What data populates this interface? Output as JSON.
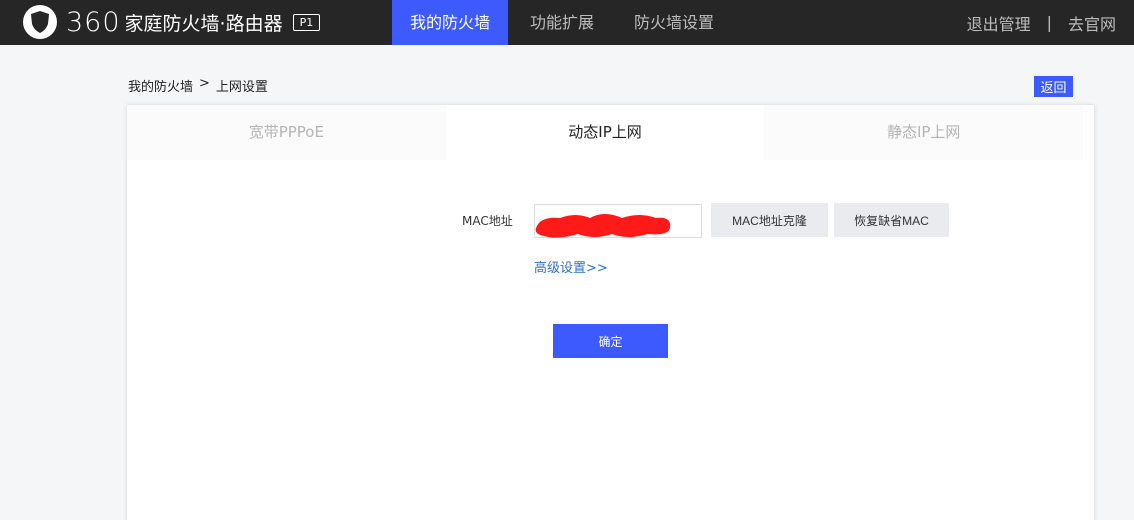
{
  "header": {
    "brand_number": "360",
    "brand_name": "家庭防火墙·路由器",
    "brand_badge": "P1",
    "nav": [
      {
        "label": "我的防火墙",
        "active": true
      },
      {
        "label": "功能扩展",
        "active": false
      },
      {
        "label": "防火墙设置",
        "active": false
      }
    ],
    "logout_label": "退出管理",
    "separator": "|",
    "website_label": "去官网"
  },
  "breadcrumb": {
    "parent": "我的防火墙",
    "separator": ">",
    "current": "上网设置"
  },
  "back_label": "返回",
  "tabs": [
    {
      "label": "宽带PPPoE",
      "active": false
    },
    {
      "label": "动态IP上网",
      "active": true
    },
    {
      "label": "静态IP上网",
      "active": false
    }
  ],
  "form": {
    "mac_label": "MAC地址",
    "mac_value": "",
    "clone_label": "MAC地址克隆",
    "restore_label": "恢复缺省MAC",
    "advanced_label": "高级设置>>",
    "confirm_label": "确定"
  },
  "colors": {
    "accent": "#3d5afe",
    "topbar": "#262626",
    "link": "#2d6fd6",
    "redaction": "#ff1a1a"
  }
}
